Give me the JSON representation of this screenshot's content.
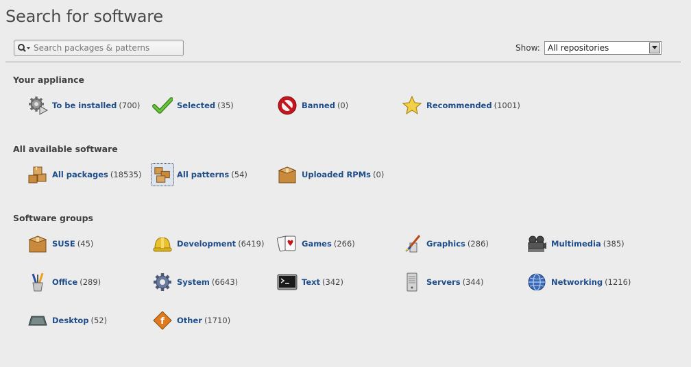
{
  "header": {
    "title": "Search for software"
  },
  "search": {
    "placeholder": "Search packages & patterns",
    "value": ""
  },
  "repo_filter": {
    "label": "Show:",
    "selected": "All repositories"
  },
  "sections": {
    "appliance": {
      "title": "Your appliance",
      "items": [
        {
          "label": "To be installed",
          "count": "(700)",
          "icon": "gear-install-icon"
        },
        {
          "label": "Selected",
          "count": "(35)",
          "icon": "checkmark-icon"
        },
        {
          "label": "Banned",
          "count": "(0)",
          "icon": "banned-icon"
        },
        {
          "label": "Recommended",
          "count": "(1001)",
          "icon": "star-icon"
        }
      ]
    },
    "available": {
      "title": "All available software",
      "items": [
        {
          "label": "All packages",
          "count": "(18535)",
          "icon": "packages-icon"
        },
        {
          "label": "All patterns",
          "count": "(54)",
          "icon": "patterns-icon"
        },
        {
          "label": "Uploaded RPMs",
          "count": "(0)",
          "icon": "box-icon"
        }
      ]
    },
    "groups": {
      "title": "Software groups",
      "items": [
        {
          "label": "SUSE",
          "count": "(45)",
          "icon": "box-icon"
        },
        {
          "label": "Development",
          "count": "(6419)",
          "icon": "hardhat-icon"
        },
        {
          "label": "Games",
          "count": "(266)",
          "icon": "cards-icon"
        },
        {
          "label": "Graphics",
          "count": "(286)",
          "icon": "paintbrush-icon"
        },
        {
          "label": "Multimedia",
          "count": "(385)",
          "icon": "film-camera-icon"
        },
        {
          "label": "Office",
          "count": "(289)",
          "icon": "pencil-cup-icon"
        },
        {
          "label": "System",
          "count": "(6643)",
          "icon": "gear-icon"
        },
        {
          "label": "Text",
          "count": "(342)",
          "icon": "terminal-icon"
        },
        {
          "label": "Servers",
          "count": "(344)",
          "icon": "server-icon"
        },
        {
          "label": "Networking",
          "count": "(1216)",
          "icon": "globe-icon"
        },
        {
          "label": "Desktop",
          "count": "(52)",
          "icon": "desktop-icon"
        },
        {
          "label": "Other",
          "count": "(1710)",
          "icon": "other-diamond-icon"
        }
      ]
    }
  }
}
